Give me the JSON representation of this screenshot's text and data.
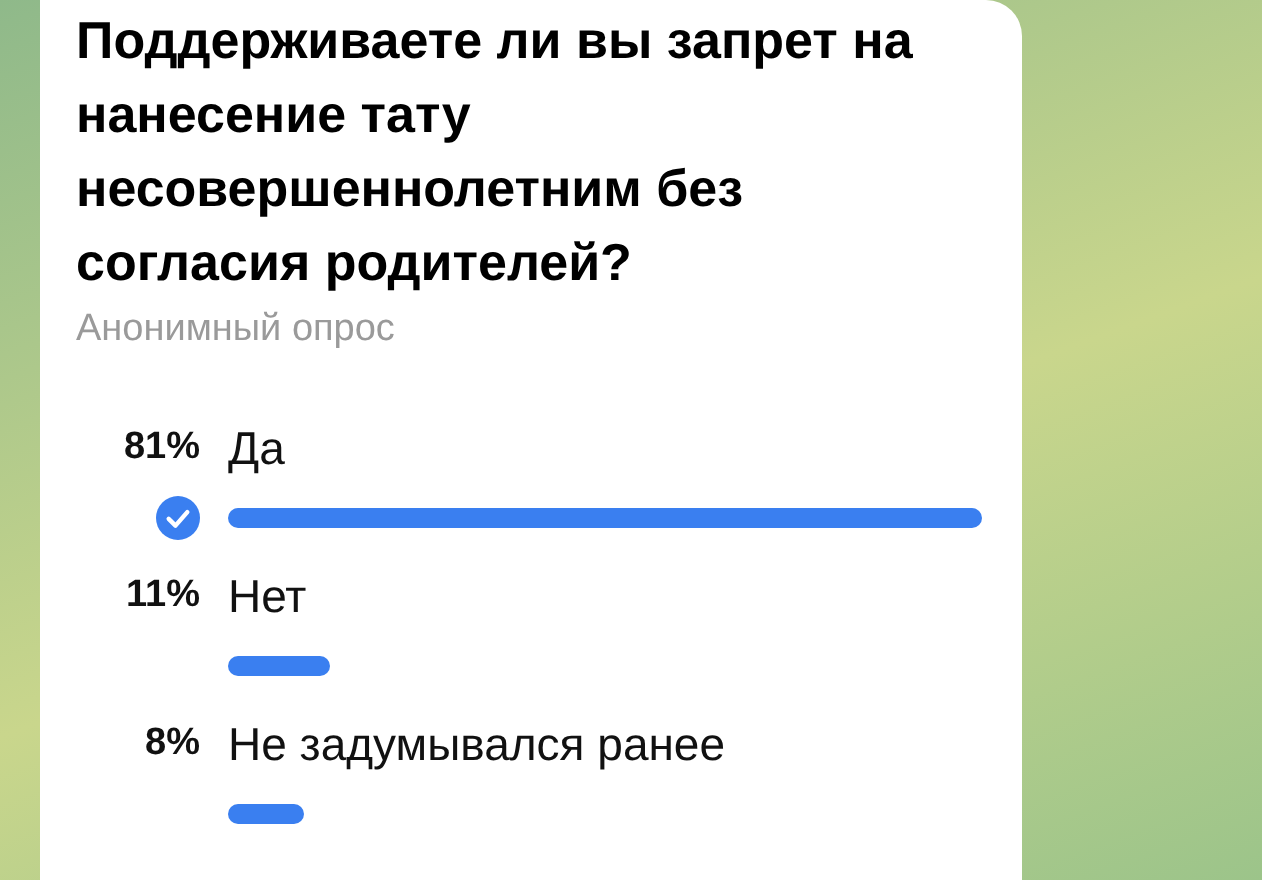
{
  "poll": {
    "question": "Поддерживаете ли вы запрет на нанесение тату несовершеннолетним без согласия родителей?",
    "subtitle": "Анонимный опрос",
    "options": [
      {
        "percent": "81%",
        "label": "Да",
        "selected": true
      },
      {
        "percent": "11%",
        "label": "Нет",
        "selected": false
      },
      {
        "percent": "8%",
        "label": "Не задумывался ранее",
        "selected": false
      }
    ]
  }
}
